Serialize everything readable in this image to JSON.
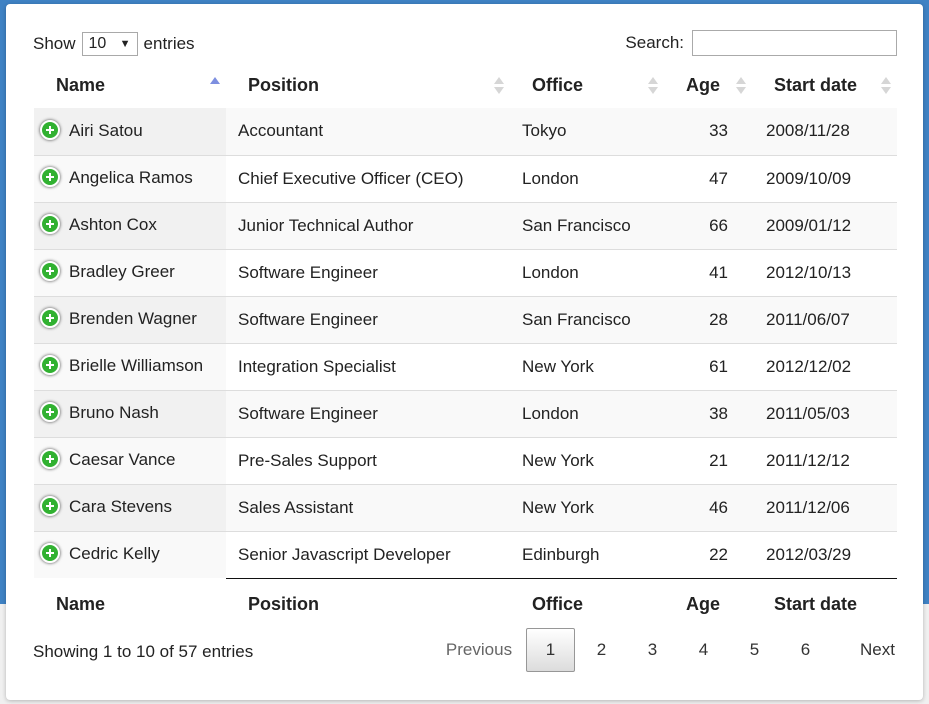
{
  "length": {
    "prefix": "Show",
    "value": "10",
    "suffix": "entries"
  },
  "search": {
    "label": "Search:",
    "value": ""
  },
  "columns": [
    "Name",
    "Position",
    "Office",
    "Age",
    "Start date"
  ],
  "rows": [
    [
      "Airi Satou",
      "Accountant",
      "Tokyo",
      "33",
      "2008/11/28"
    ],
    [
      "Angelica Ramos",
      "Chief Executive Officer (CEO)",
      "London",
      "47",
      "2009/10/09"
    ],
    [
      "Ashton Cox",
      "Junior Technical Author",
      "San Francisco",
      "66",
      "2009/01/12"
    ],
    [
      "Bradley Greer",
      "Software Engineer",
      "London",
      "41",
      "2012/10/13"
    ],
    [
      "Brenden Wagner",
      "Software Engineer",
      "San Francisco",
      "28",
      "2011/06/07"
    ],
    [
      "Brielle Williamson",
      "Integration Specialist",
      "New York",
      "61",
      "2012/12/02"
    ],
    [
      "Bruno Nash",
      "Software Engineer",
      "London",
      "38",
      "2011/05/03"
    ],
    [
      "Caesar Vance",
      "Pre-Sales Support",
      "New York",
      "21",
      "2011/12/12"
    ],
    [
      "Cara Stevens",
      "Sales Assistant",
      "New York",
      "46",
      "2011/12/06"
    ],
    [
      "Cedric Kelly",
      "Senior Javascript Developer",
      "Edinburgh",
      "22",
      "2012/03/29"
    ]
  ],
  "info": "Showing 1 to 10 of 57 entries",
  "pagination": {
    "previous": "Previous",
    "next": "Next",
    "pages": [
      "1",
      "2",
      "3",
      "4",
      "5",
      "6"
    ],
    "current": "1"
  },
  "icons": {
    "expand": "plus-circle-icon",
    "sort_asc": "sort-asc-icon",
    "sort_both": "sort-both-icon"
  },
  "colors": {
    "accent": "#3f82c4",
    "expand": "#31b131",
    "sort_active": "#7d8fe0"
  }
}
